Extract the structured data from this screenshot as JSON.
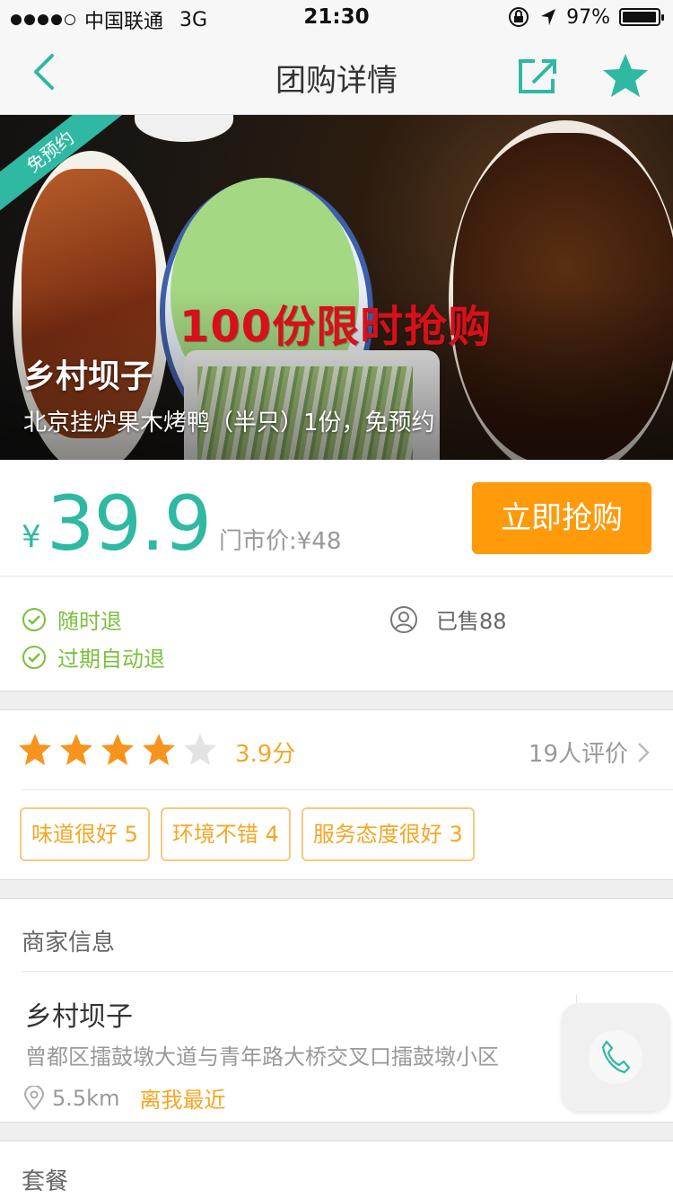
{
  "status_bar": {
    "carrier": "中国联通",
    "network": "3G",
    "time": "21:30",
    "battery": "97%",
    "battery_level": 0.97
  },
  "nav": {
    "title": "团购详情",
    "back_icon": "chevron-left-icon",
    "share_icon": "share-icon",
    "favorite_icon": "star-icon"
  },
  "hero": {
    "badge": "免预约",
    "promo_text": "100份限时抢购",
    "shop_name": "乡村坝子",
    "deal_desc": "北京挂炉果木烤鸭（半只）1份，免预约"
  },
  "price": {
    "currency": "¥",
    "current": "39.9",
    "original_label": "门市价:¥48",
    "buy_label": "立即抢购"
  },
  "guarantees": {
    "items": [
      "随时退",
      "过期自动退"
    ],
    "sold_label": "已售88"
  },
  "rating": {
    "stars": 4,
    "max_stars": 5,
    "score_label": "3.9分",
    "reviews_label": "19人评价",
    "tags": [
      "味道很好 5",
      "环境不错 4",
      "服务态度很好 3"
    ]
  },
  "merchant": {
    "header": "商家信息",
    "name": "乡村坝子",
    "address": "曾都区擂鼓墩大道与青年路大桥交叉口擂鼓墩小区",
    "distance": "5.5km",
    "nearest_label": "离我最近"
  },
  "package": {
    "header": "套餐"
  },
  "colors": {
    "accent": "#2fb8a2",
    "buy": "#ff9a0b",
    "rating": "#f5a623",
    "guarantee": "#7cbf3d"
  }
}
